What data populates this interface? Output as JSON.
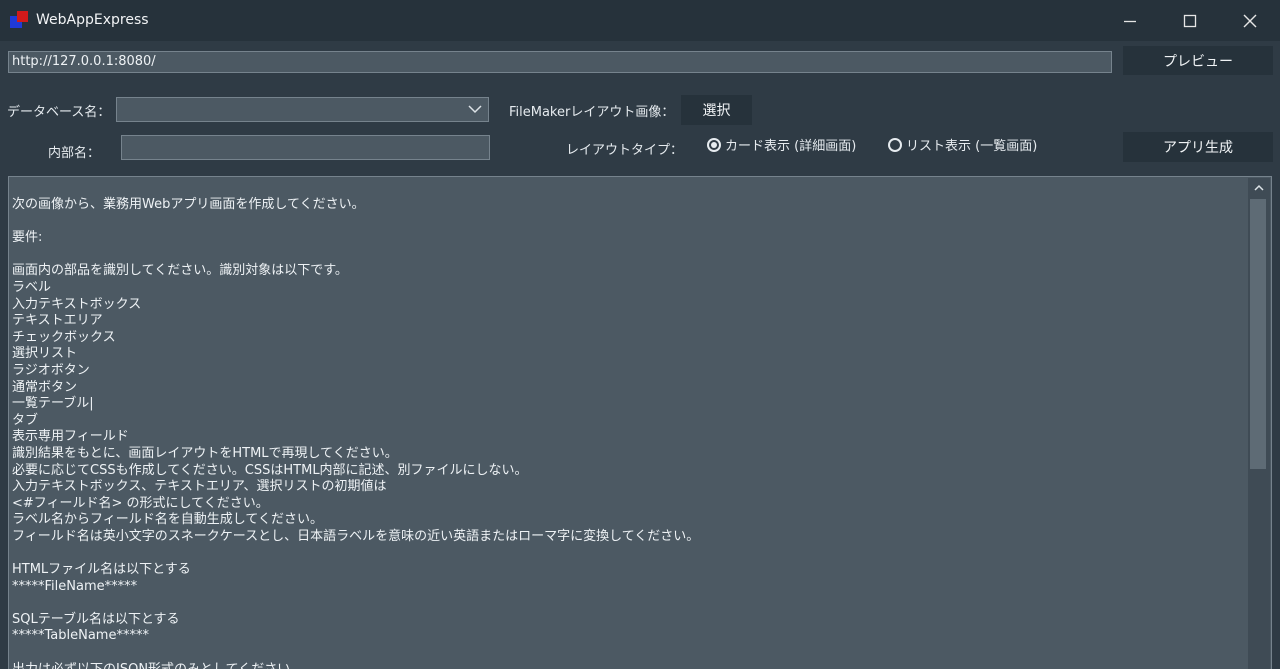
{
  "window": {
    "title": "WebAppExpress",
    "minimize": "–",
    "maximize": "☐",
    "close": "✕"
  },
  "url_bar": {
    "value": "http://127.0.0.1:8080/"
  },
  "buttons": {
    "preview": "プレビュー",
    "select": "選択",
    "generate": "アプリ生成"
  },
  "form": {
    "database_label": "データベース名：",
    "database_value": "",
    "internal_name_label": "内部名：",
    "internal_name_value": "",
    "filemaker_label": "FileMakerレイアウト画像：",
    "layout_type_label": "レイアウトタイプ：",
    "radio_card": "カード表示 (詳細画面)",
    "radio_list": "リスト表示 (一覧画面)",
    "selected_layout": "card"
  },
  "editor": {
    "lines": [
      "次の画像から、業務用Webアプリ画面を作成してください。",
      "",
      "要件:",
      "",
      "画面内の部品を識別してください。識別対象は以下です。",
      "ラベル",
      "入力テキストボックス",
      "テキストエリア",
      "チェックボックス",
      "選択リスト",
      "ラジオボタン",
      "通常ボタン",
      "一覧テーブル|",
      "タブ",
      "表示専用フィールド",
      "識別結果をもとに、画面レイアウトをHTMLで再現してください。",
      "必要に応じてCSSも作成してください。CSSはHTML内部に記述、別ファイルにしない。",
      "入力テキストボックス、テキストエリア、選択リストの初期値は",
      "<#フィールド名> の形式にしてください。",
      "ラベル名からフィールド名を自動生成してください。",
      "フィールド名は英小文字のスネークケースとし、日本語ラベルを意味の近い英語またはローマ字に変換してください。",
      "",
      "HTMLファイル名は以下とする",
      "*****FileName*****",
      "",
      "SQLテーブル名は以下とする",
      "*****TableName*****",
      "",
      "出力は必ず以下のJSON形式のみとしてください。"
    ]
  },
  "icons": {
    "logo": "app-logo-icon",
    "dropdown": "chevron-down-icon",
    "scroll_up": "chevron-up-icon"
  }
}
